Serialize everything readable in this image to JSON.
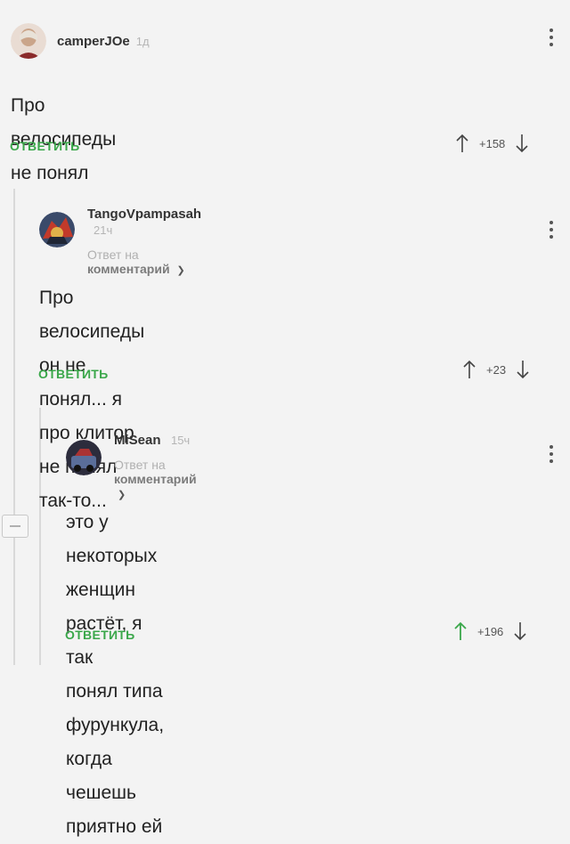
{
  "comments": [
    {
      "username": "camperJOe",
      "time": "1д",
      "reply_to": "",
      "text_lines": [
        "Про велосипеды не понял"
      ],
      "answer_label": "ОТВЕТИТЬ",
      "rating": "+158"
    },
    {
      "username": "TangoVpampasah",
      "time": "21ч",
      "reply_to": {
        "prefix": "Ответ на",
        "target": "комментарий"
      },
      "text_lines": [
        "Про велосипеды он не понял... я про клитор",
        "не понял так-то..."
      ],
      "answer_label": "ОТВЕТИТЬ",
      "rating": "+23"
    },
    {
      "username": "MiSean",
      "time": "15ч",
      "reply_to": {
        "prefix": "Ответ на",
        "target": "комментарий"
      },
      "text_lines": [
        "это у некоторых женщин растёт, я так",
        "понял типа фурункула, когда чешешь",
        "приятно ей"
      ],
      "answer_label": "ОТВЕТИТЬ",
      "rating": "+196"
    }
  ],
  "colors": {
    "accent_green": "#3aa74a",
    "upvote_active": "#3aa74a",
    "background": "#f3f3f3"
  },
  "icons": [
    "avatar",
    "more-vertical-icon",
    "arrow-up-icon",
    "arrow-down-icon",
    "chevron-down-icon",
    "collapse-icon"
  ]
}
